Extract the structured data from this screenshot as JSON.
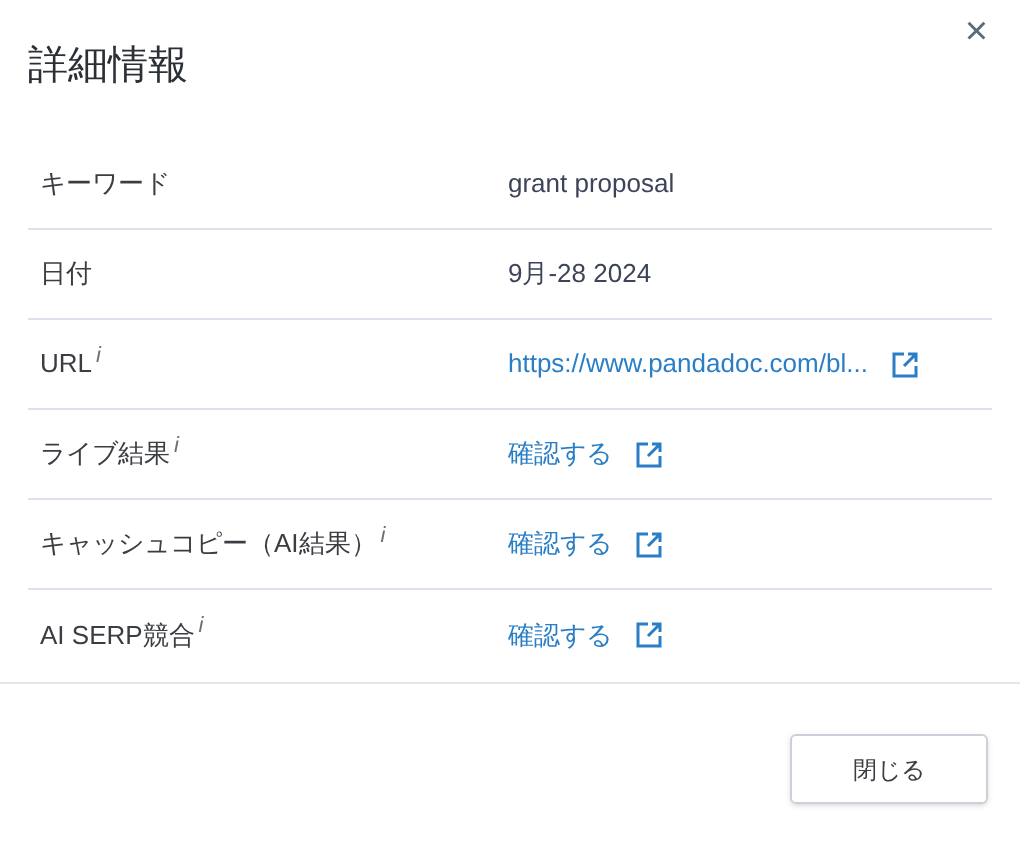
{
  "dialog": {
    "title": "詳細情報",
    "close": "×"
  },
  "rows": [
    {
      "label": "キーワード",
      "value": "grant proposal",
      "kind": "text"
    },
    {
      "label": "日付",
      "value": "9月-28 2024",
      "kind": "text"
    },
    {
      "label": "URL",
      "info": "i",
      "value": "https://www.pandadoc.com/bl...",
      "kind": "link"
    },
    {
      "label": "ライブ結果",
      "info": "i",
      "value": "確認する",
      "kind": "link"
    },
    {
      "label": "キャッシュコピー（AI結果）",
      "info": "i",
      "value": "確認する",
      "kind": "link"
    },
    {
      "label": "AI SERP競合",
      "info": "i",
      "value": "確認する",
      "kind": "link"
    }
  ],
  "buttons": [
    "閉じる"
  ]
}
